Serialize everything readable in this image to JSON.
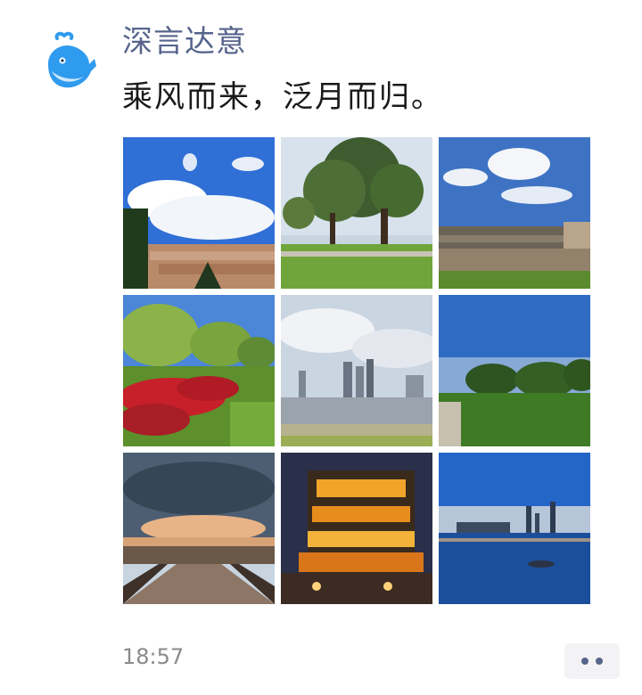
{
  "post": {
    "author": "深言达意",
    "text": "乘风而来，泛月而归。",
    "time": "18:57"
  },
  "avatar": {
    "icon": "whale-icon",
    "color": "#2f9bef"
  },
  "photos": [
    {
      "scene": "sky-clouds-city-rooftops"
    },
    {
      "scene": "park-large-trees-lawn"
    },
    {
      "scene": "river-bridge-cloudy-sky"
    },
    {
      "scene": "willow-trees-red-flowers"
    },
    {
      "scene": "city-skyline-cloudy"
    },
    {
      "scene": "green-lawn-blue-sky"
    },
    {
      "scene": "sunset-bridge-road"
    },
    {
      "scene": "illuminated-night-building"
    },
    {
      "scene": "night-skyline-waterfront"
    }
  ],
  "more_icon": "more-dots-icon",
  "colors": {
    "author": "#56648c",
    "text": "#1a1a1a",
    "time": "#8a8a8a"
  }
}
